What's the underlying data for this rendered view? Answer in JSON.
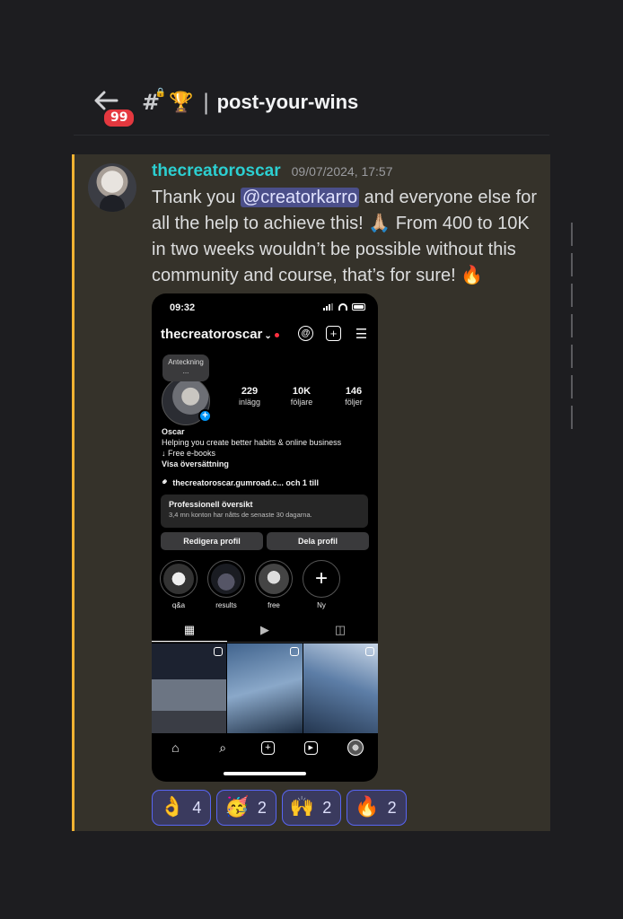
{
  "header": {
    "back_badge": "99",
    "channel_name": "post-your-wins",
    "separator": "|",
    "trophy": "🏆"
  },
  "message": {
    "author": "thecreatoroscar",
    "timestamp": "09/07/2024, 17:57",
    "text_before": "Thank you ",
    "mention": "@creatorkarro",
    "text_after": " and everyone else for all the help to achieve this! 🙏🏼 From 400 to 10K in two weeks wouldn’t be possible without this community and course, that’s for sure! 🔥",
    "accent_color": "#f0b232"
  },
  "phone": {
    "time": "09:32",
    "username": "thecreatoroscar",
    "note": "Anteckning ...",
    "stats": [
      {
        "num": "229",
        "label": "inlägg"
      },
      {
        "num": "10K",
        "label": "följare"
      },
      {
        "num": "146",
        "label": "följer"
      }
    ],
    "bio_name": "Oscar",
    "bio_line1": "Helping you create better habits & online business",
    "bio_line2": "↓ Free e-books",
    "bio_translate": "Visa översättning",
    "link": "thecreatoroscar.gumroad.c...  och 1 till",
    "pro_title": "Professionell översikt",
    "pro_sub": "3,4 mn konton har nåtts de senaste 30 dagarna.",
    "btn_edit": "Redigera profil",
    "btn_share": "Dela profil",
    "highlights": [
      "q&a",
      "results",
      "free",
      "Ny"
    ]
  },
  "reactions": [
    {
      "emoji": "👌",
      "count": "4"
    },
    {
      "emoji": "🥳",
      "count": "2"
    },
    {
      "emoji": "🙌",
      "count": "2"
    },
    {
      "emoji": "🔥",
      "count": "2"
    }
  ]
}
